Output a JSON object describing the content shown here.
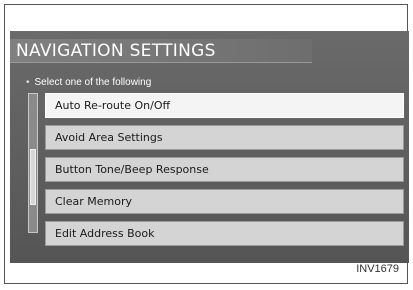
{
  "screen": {
    "title": "NAVIGATION SETTINGS",
    "instruction": "Select one of the following",
    "menu_items": [
      {
        "label": "Auto Re-route On/Off",
        "selected": true
      },
      {
        "label": "Avoid Area Settings",
        "selected": false
      },
      {
        "label": "Button Tone/Beep Response",
        "selected": false
      },
      {
        "label": "Clear Memory",
        "selected": false
      },
      {
        "label": "Edit Address Book",
        "selected": false
      }
    ]
  },
  "figure_code": "INV1679",
  "colors": {
    "screen_bg": "#5a5a5a",
    "item_bg": "#d4d4d4",
    "item_selected_bg": "#f4f4f4",
    "title_text": "#ffffff"
  }
}
